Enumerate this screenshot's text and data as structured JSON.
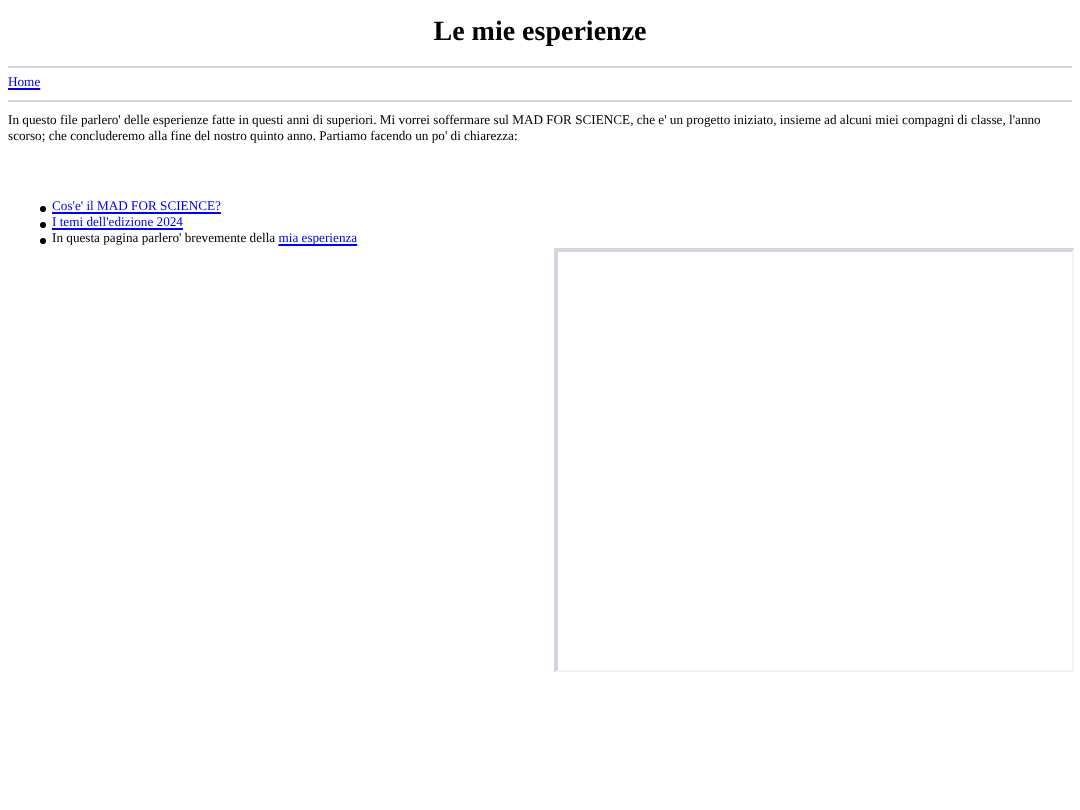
{
  "title": "Le mie esperienze",
  "nav": {
    "link": "Home"
  },
  "intro": "In questo file parlero' delle esperienze fatte in questi anni di superiori. Mi vorrei soffermare sul MAD FOR SCIENCE, che e' un progetto iniziato, insieme ad alcuni miei compagni di classe, l'anno scorso; che concluderemo alla fine del nostro quinto anno. Partiamo facendo un po' di chiarezza:",
  "list": [
    {
      "kind": "link",
      "link": "Cos'e' il MAD FOR SCIENCE?"
    },
    {
      "kind": "link",
      "link": "I temi dell'edizione 2024"
    },
    {
      "kind": "mixed",
      "text": "In questa pagina parlero' brevemente della ",
      "link": "mia esperienza"
    }
  ]
}
